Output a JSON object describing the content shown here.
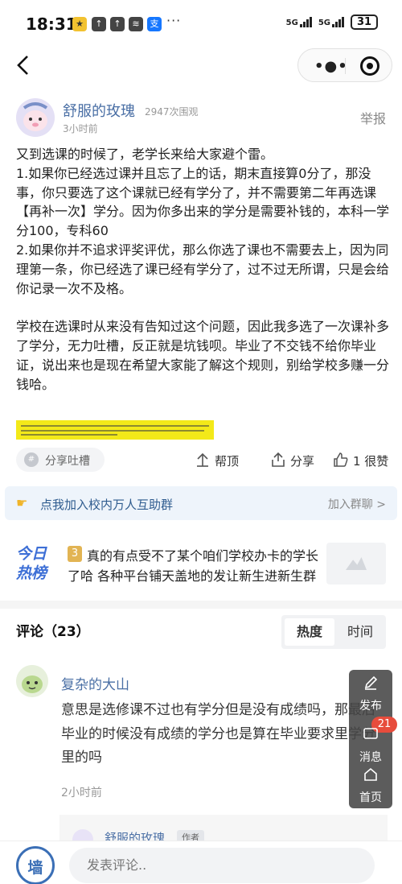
{
  "status_bar": {
    "time": "18:31",
    "dots": "···",
    "signal_1": "5G",
    "signal_2": "5G",
    "battery": "31"
  },
  "post": {
    "author": "舒服的玫瑰",
    "views": "2947次围观",
    "time": "3小时前",
    "report_label": "举报",
    "paragraph_1": "又到选课的时候了，老学长来给大家避个雷。\n1.如果你已经选过课并且忘了上的话，期末直接算0分了，那没事，你只要选了这个课就已经有学分了，并不需要第二年再选课【再补一次】学分。因为你多出来的学分是需要补钱的，本科一学分100，专科60\n2.如果你并不追求评奖评优，那么你选了课也不需要去上，因为同理第一条，你已经选了课已经有学分了，过不过无所谓，只是会给你记录一次不及格。",
    "paragraph_2": "学校在选课时从来没有告知过这个问题，因此我多选了一次课补多了学分，无力吐槽，反正就是坑钱呗。毕业了不交钱不给你毕业证，说出来也是现在希望大家能了解这个规则，别给学校多赚一分钱哈。"
  },
  "actions": {
    "share_talk": "分享吐槽",
    "boost": "帮顶",
    "share": "分享",
    "like": "1 很赞"
  },
  "join_bar": {
    "text": "点我加入校内万人互助群",
    "button": "加入群聊 >"
  },
  "hot": {
    "logo_line1": "今日",
    "logo_line2": "热榜",
    "rank": "3",
    "text": "真的有点受不了某个咱们学校办卡的学长了哈 各种平台铺天盖地的发让新生进新生群"
  },
  "comments": {
    "title": "评论（23）",
    "sort_hot": "热度",
    "sort_time": "时间",
    "first": {
      "author": "复杂的大山",
      "text": "意思是选修课不过也有学分但是没有成绩吗，那最后毕业的时候没有成绩的学分也是算在毕业要求里学分里的吗",
      "time": "2小时前"
    },
    "reply": {
      "author": "舒服的玫瑰",
      "tag": "作者"
    }
  },
  "float_menu": {
    "publish": "发布",
    "messages": "消息",
    "badge": "21",
    "home": "首页"
  },
  "bottom": {
    "logo_char": "墙",
    "comment_placeholder": "发表评论.."
  },
  "colors": {
    "link_blue": "#4a6fa5",
    "highlight_yellow": "#f3e919",
    "badge_red": "#e74c3c"
  }
}
